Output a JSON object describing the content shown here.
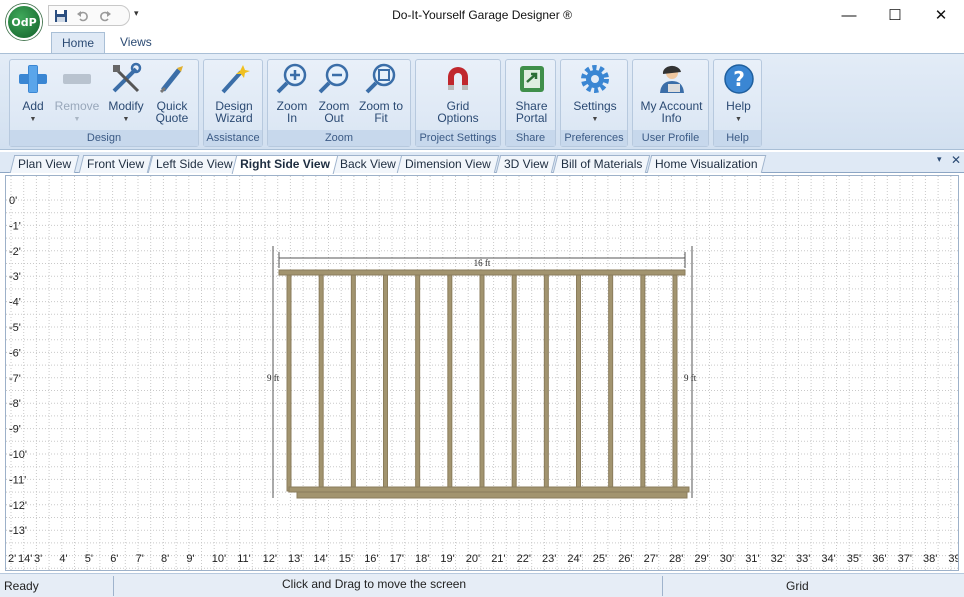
{
  "window": {
    "title": "Do-It-Yourself Garage Designer ®",
    "logo_text": "OdP",
    "minimize": "—",
    "maximize": "☐",
    "close": "✕"
  },
  "qat": {
    "save_icon": "save-icon",
    "undo_icon": "undo-icon",
    "redo_icon": "redo-icon",
    "dropdown": "▾"
  },
  "ribbon_tabs": [
    "Home",
    "Views"
  ],
  "ribbon": {
    "groups": [
      {
        "caption": "Design",
        "buttons": [
          {
            "label1": "Add",
            "label2": "",
            "icon": "add-icon",
            "arrow": true,
            "enabled": true
          },
          {
            "label1": "Remove",
            "label2": "",
            "icon": "remove-icon",
            "arrow": true,
            "enabled": false
          },
          {
            "label1": "Modify",
            "label2": "",
            "icon": "tools-icon",
            "arrow": true,
            "enabled": true
          },
          {
            "label1": "Quick",
            "label2": "Quote",
            "icon": "quote-icon",
            "arrow": false,
            "enabled": true
          }
        ]
      },
      {
        "caption": "Assistance",
        "buttons": [
          {
            "label1": "Design",
            "label2": "Wizard",
            "icon": "wand-icon",
            "arrow": false,
            "enabled": true
          }
        ]
      },
      {
        "caption": "Zoom",
        "buttons": [
          {
            "label1": "Zoom",
            "label2": "In",
            "icon": "zoom-in-icon",
            "arrow": false,
            "enabled": true
          },
          {
            "label1": "Zoom",
            "label2": "Out",
            "icon": "zoom-out-icon",
            "arrow": false,
            "enabled": true
          },
          {
            "label1": "Zoom to",
            "label2": "Fit",
            "icon": "zoom-fit-icon",
            "arrow": false,
            "enabled": true
          }
        ]
      },
      {
        "caption": "Project Settings",
        "buttons": [
          {
            "label1": "Grid",
            "label2": "Options",
            "icon": "magnet-icon",
            "arrow": false,
            "enabled": true
          }
        ]
      },
      {
        "caption": "Share",
        "buttons": [
          {
            "label1": "Share",
            "label2": "Portal",
            "icon": "share-icon",
            "arrow": false,
            "enabled": true
          }
        ]
      },
      {
        "caption": "Preferences",
        "buttons": [
          {
            "label1": "Settings",
            "label2": "",
            "icon": "gear-icon",
            "arrow": true,
            "enabled": true
          }
        ]
      },
      {
        "caption": "User Profile",
        "buttons": [
          {
            "label1": "My Account",
            "label2": "Info",
            "icon": "user-icon",
            "arrow": false,
            "enabled": true
          }
        ]
      },
      {
        "caption": "Help",
        "buttons": [
          {
            "label1": "Help",
            "label2": "",
            "icon": "help-icon",
            "arrow": true,
            "enabled": true
          }
        ]
      }
    ]
  },
  "doc_tabs": {
    "items": [
      "Plan View",
      "Front View",
      "Left Side View",
      "Right Side View",
      "Back View",
      "Dimension View",
      "3D View",
      "Bill of Materials",
      "Home Visualization"
    ],
    "active": "Right Side View",
    "dropdown": "▾",
    "close": "✕"
  },
  "canvas": {
    "y_ruler": [
      "0'",
      "-1'",
      "-2'",
      "-3'",
      "-4'",
      "-5'",
      "-6'",
      "-7'",
      "-8'",
      "-9'",
      "-10'",
      "-11'",
      "-12'",
      "-13'"
    ],
    "x_ruler": [
      "2'",
      "14'",
      "3'",
      "4'",
      "5'",
      "6'",
      "7'",
      "8'",
      "9'",
      "10'",
      "11'",
      "12'",
      "13'",
      "14'",
      "15'",
      "16'",
      "17'",
      "18'",
      "19'",
      "20'",
      "21'",
      "22'",
      "23'",
      "24'",
      "25'",
      "26'",
      "27'",
      "28'",
      "29'",
      "30'",
      "31'",
      "32'",
      "33'",
      "34'",
      "35'",
      "36'",
      "37'",
      "38'",
      "39'"
    ],
    "wall": {
      "width_label": "16 ft",
      "height_label_left": "9 ft",
      "height_label_right": "9 ft",
      "stud_count": 13,
      "lumber_color": "#8b7d5c",
      "lumber_fill": "#a2946f"
    }
  },
  "status": {
    "left": "Ready",
    "center": "Click and Drag to move the screen",
    "right": "Grid"
  }
}
